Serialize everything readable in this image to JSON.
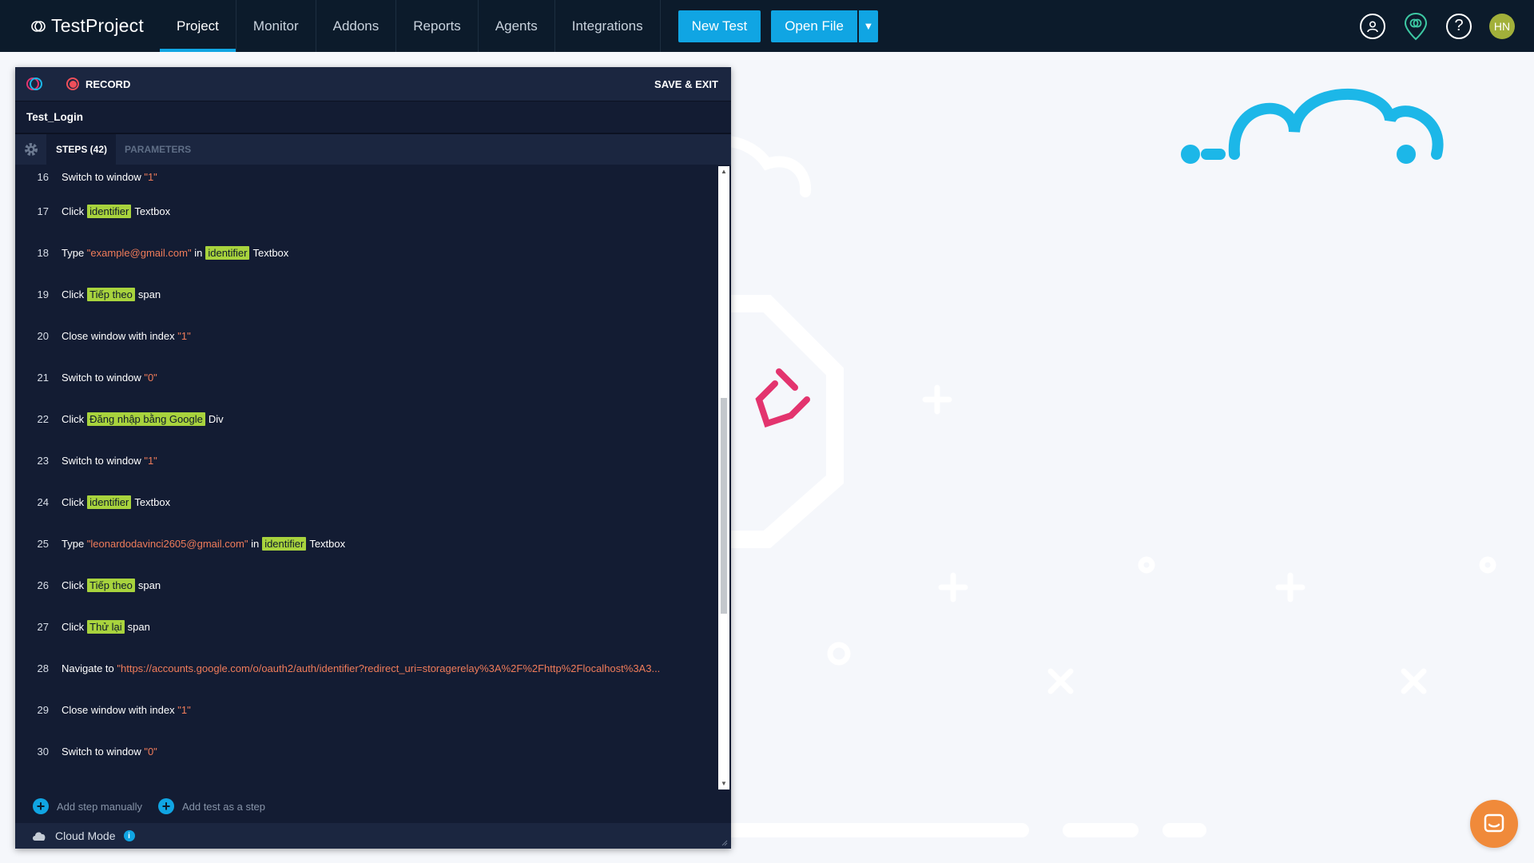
{
  "app": {
    "brand": "TestProject",
    "accent": "#10a5e3"
  },
  "nav": {
    "items": [
      {
        "label": "Project",
        "active": true
      },
      {
        "label": "Monitor"
      },
      {
        "label": "Addons"
      },
      {
        "label": "Reports"
      },
      {
        "label": "Agents"
      },
      {
        "label": "Integrations"
      }
    ],
    "new_test": "New Test",
    "open_file": "Open File",
    "avatar_initials": "HN"
  },
  "recorder": {
    "record_label": "RECORD",
    "save_exit_label": "SAVE & EXIT",
    "test_name": "Test_Login",
    "tabs": [
      {
        "label": "STEPS (42)",
        "active": true
      },
      {
        "label": "PARAMETERS"
      }
    ],
    "steps": [
      {
        "num": "16",
        "parts": [
          {
            "t": "text",
            "v": "Switch to window "
          },
          {
            "t": "str",
            "v": "\"1\""
          }
        ]
      },
      {
        "num": "17",
        "parts": [
          {
            "t": "text",
            "v": "Click"
          },
          {
            "t": "tag",
            "v": "identifier"
          },
          {
            "t": "text",
            "v": "Textbox"
          }
        ]
      },
      {
        "num": "18",
        "parts": [
          {
            "t": "text",
            "v": "Type "
          },
          {
            "t": "str",
            "v": "\"example@gmail.com\""
          },
          {
            "t": "text",
            "v": " in"
          },
          {
            "t": "tag",
            "v": "identifier"
          },
          {
            "t": "text",
            "v": "Textbox"
          }
        ]
      },
      {
        "num": "19",
        "parts": [
          {
            "t": "text",
            "v": "Click"
          },
          {
            "t": "tag",
            "v": "Tiếp theo"
          },
          {
            "t": "text",
            "v": "span"
          }
        ]
      },
      {
        "num": "20",
        "parts": [
          {
            "t": "text",
            "v": "Close window with index "
          },
          {
            "t": "str",
            "v": "\"1\""
          }
        ]
      },
      {
        "num": "21",
        "parts": [
          {
            "t": "text",
            "v": "Switch to window "
          },
          {
            "t": "str",
            "v": "\"0\""
          }
        ]
      },
      {
        "num": "22",
        "parts": [
          {
            "t": "text",
            "v": "Click"
          },
          {
            "t": "tag",
            "v": "Đăng nhập bằng Google"
          },
          {
            "t": "text",
            "v": "Div"
          }
        ]
      },
      {
        "num": "23",
        "parts": [
          {
            "t": "text",
            "v": "Switch to window "
          },
          {
            "t": "str",
            "v": "\"1\""
          }
        ]
      },
      {
        "num": "24",
        "parts": [
          {
            "t": "text",
            "v": "Click"
          },
          {
            "t": "tag",
            "v": "identifier"
          },
          {
            "t": "text",
            "v": "Textbox"
          }
        ]
      },
      {
        "num": "25",
        "parts": [
          {
            "t": "text",
            "v": "Type "
          },
          {
            "t": "str",
            "v": "\"leonardodavinci2605@gmail.com\""
          },
          {
            "t": "text",
            "v": " in"
          },
          {
            "t": "tag",
            "v": "identifier"
          },
          {
            "t": "text",
            "v": "Textbox"
          }
        ]
      },
      {
        "num": "26",
        "parts": [
          {
            "t": "text",
            "v": "Click"
          },
          {
            "t": "tag",
            "v": "Tiếp theo"
          },
          {
            "t": "text",
            "v": "span"
          }
        ]
      },
      {
        "num": "27",
        "parts": [
          {
            "t": "text",
            "v": "Click"
          },
          {
            "t": "tag",
            "v": "Thử lại"
          },
          {
            "t": "text",
            "v": "span"
          }
        ]
      },
      {
        "num": "28",
        "parts": [
          {
            "t": "text",
            "v": "Navigate to "
          },
          {
            "t": "str",
            "v": "\"https://accounts.google.com/o/oauth2/auth/identifier?redirect_uri=storagerelay%3A%2F%2Fhttp%2Flocalhost%3A3..."
          }
        ]
      },
      {
        "num": "29",
        "parts": [
          {
            "t": "text",
            "v": "Close window with index "
          },
          {
            "t": "str",
            "v": "\"1\""
          }
        ]
      },
      {
        "num": "30",
        "parts": [
          {
            "t": "text",
            "v": "Switch to window "
          },
          {
            "t": "str",
            "v": "\"0\""
          }
        ]
      }
    ],
    "add_step_label": "Add step manually",
    "add_test_label": "Add test as a step",
    "cloud_mode_label": "Cloud Mode"
  }
}
